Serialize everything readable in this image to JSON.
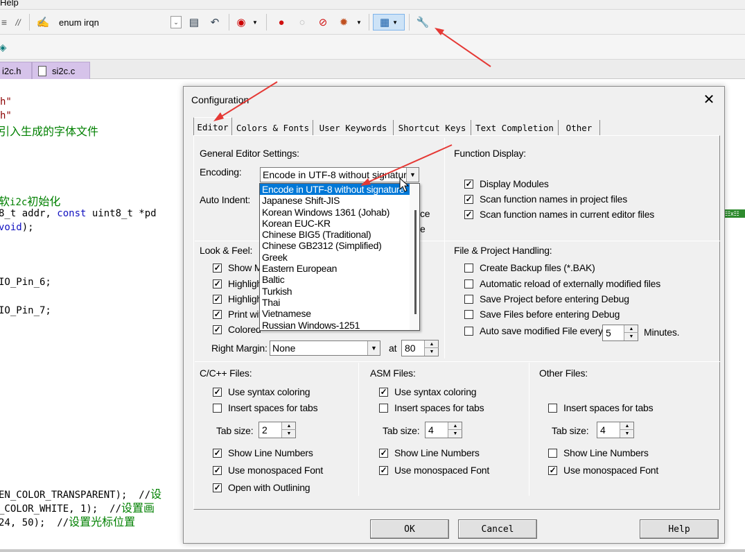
{
  "menubar": {
    "item": "Help"
  },
  "toolbar": {
    "find_value": "enum irqn"
  },
  "tabs": [
    {
      "label": "i2c.h"
    },
    {
      "label": "si2c.c"
    }
  ],
  "code": {
    "l1": "h\"",
    "l2": "h\"",
    "l3": "引入生成的字体文件",
    "l4a": "软",
    "l4b": "i2c",
    "l4c": "初始化",
    "l5a": "8_t addr, ",
    "l5b": "const",
    "l5c": " uint8_t *pd",
    "l6a": "void",
    "l6b": ");",
    "l7": "IO_Pin_6;",
    "l8": "IO_Pin_7;",
    "l9a": "EN_COLOR_TRANSPARENT);  //",
    "l9b": "设",
    "l10a": "_COLOR_WHITE, 1);  //",
    "l10b": "设置画",
    "l11a": "24, 50);  //",
    "l11b": "设置光标位置",
    "badge": "☷x☷"
  },
  "dialog": {
    "title": "Configuration",
    "close": "✕",
    "tabs": [
      "Editor",
      "Colors & Fonts",
      "User Keywords",
      "Shortcut Keys",
      "Text Completion",
      "Other"
    ],
    "general": {
      "heading": "General Editor Settings:",
      "encoding_label": "Encoding:",
      "encoding_value": "Encode in UTF-8 without signature",
      "auto_indent_label": "Auto Indent:",
      "hidden_ce": "ce",
      "hidden_e": "e"
    },
    "encoding_options": [
      "Encode in UTF-8 without signature",
      "Japanese Shift-JIS",
      "Korean Windows 1361 (Johab)",
      "Korean EUC-KR",
      "Chinese BIG5 (Traditional)",
      "Chinese GB2312 (Simplified)",
      "Greek",
      "Eastern European",
      "Baltic",
      "Turkish",
      "Thai",
      "Vietnamese",
      "Russian Windows-1251"
    ],
    "function_display": {
      "heading": "Function Display:",
      "items": [
        {
          "label": "Display Modules",
          "checked": true
        },
        {
          "label": "Scan function names in project files",
          "checked": true
        },
        {
          "label": "Scan function names in current editor files",
          "checked": true
        }
      ]
    },
    "look_feel": {
      "heading": "Look & Feel:",
      "items": [
        {
          "label": "Show M",
          "checked": true
        },
        {
          "label": "Highligh",
          "checked": true
        },
        {
          "label": "Highligh",
          "checked": true
        },
        {
          "label": "Print wit",
          "checked": true
        },
        {
          "label": "Colored",
          "checked": true
        }
      ],
      "right_margin_label": "Right Margin:",
      "right_margin_value": "None",
      "at_label": "at",
      "at_value": "80"
    },
    "file_project": {
      "heading": "File & Project Handling:",
      "items": [
        {
          "label": "Create Backup files (*.BAK)",
          "checked": false
        },
        {
          "label": "Automatic reload of externally modified files",
          "checked": false
        },
        {
          "label": "Save Project before entering Debug",
          "checked": false
        },
        {
          "label": "Save Files before entering Debug",
          "checked": false
        }
      ],
      "autosave_label": "Auto save modified File every",
      "autosave_value": "5",
      "minutes_label": "Minutes."
    },
    "cpp": {
      "heading": "C/C++ Files:",
      "syntax": "Use syntax coloring",
      "spaces": "Insert spaces for tabs",
      "tab_size_label": "Tab size:",
      "tab_size": "2",
      "line_numbers": "Show Line Numbers",
      "monospaced": "Use monospaced Font",
      "outlining": "Open with Outlining"
    },
    "asm": {
      "heading": "ASM Files:",
      "syntax": "Use syntax coloring",
      "spaces": "Insert spaces for tabs",
      "tab_size_label": "Tab size:",
      "tab_size": "4",
      "line_numbers": "Show Line Numbers",
      "monospaced": "Use monospaced Font"
    },
    "other": {
      "heading": "Other Files:",
      "spaces": "Insert spaces for tabs",
      "tab_size_label": "Tab size:",
      "tab_size": "4",
      "line_numbers": "Show Line Numbers",
      "monospaced": "Use monospaced Font"
    },
    "buttons": {
      "ok": "OK",
      "cancel": "Cancel",
      "help": "Help"
    }
  },
  "colors": {
    "annotation_arrow": "#e53935",
    "selection": "#0078d7",
    "tab_purple": "#d6c3ea"
  }
}
